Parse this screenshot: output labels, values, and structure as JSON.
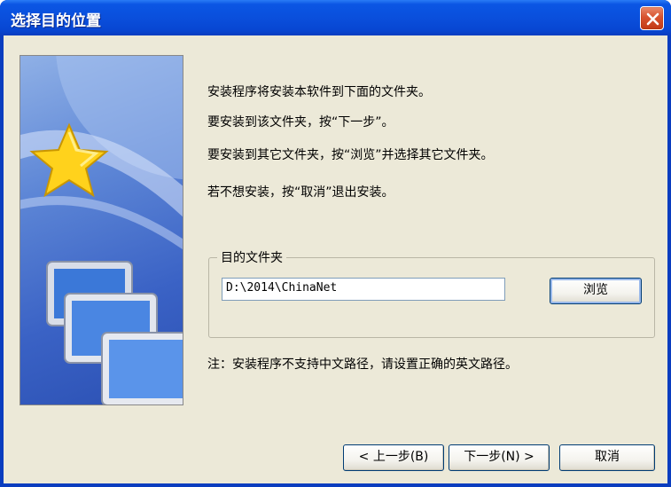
{
  "window": {
    "title": "选择目的位置"
  },
  "instructions": [
    "安装程序将安装本软件到下面的文件夹。",
    "要安装到该文件夹，按“下一步”。",
    "要安装到其它文件夹，按“浏览”并选择其它文件夹。",
    "若不想安装，按“取消”退出安装。"
  ],
  "destination": {
    "group_label": "目的文件夹",
    "path_value": "D:\\2014\\ChinaNet",
    "browse_label": "浏览"
  },
  "note": "注：安装程序不支持中文路径，请设置正确的英文路径。",
  "buttons": {
    "back": "< 上一步(B)",
    "next": "下一步(N) >",
    "cancel": "取消"
  },
  "icons": {
    "close": "close-icon",
    "star": "star-icon",
    "monitors": "monitor-icon"
  },
  "colors": {
    "titlebar": "#0a4fdc",
    "dialog_bg": "#ece9d8",
    "close_button": "#d8532f"
  }
}
